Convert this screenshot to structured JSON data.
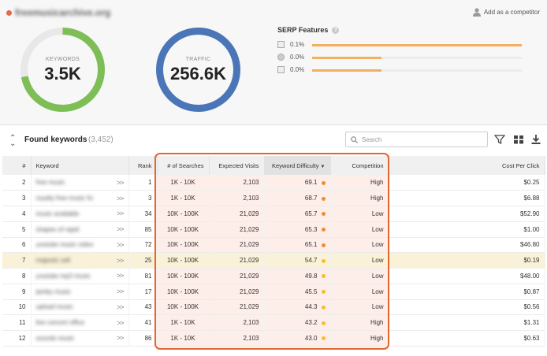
{
  "header": {
    "domain": "freemusicarchive.org",
    "add_competitor_label": "Add as a competitor",
    "add_competitor_icon": "user-icon"
  },
  "keywords_donut": {
    "label": "KEYWORDS",
    "value": "3.5K",
    "fill_fraction": 0.72,
    "color": "#7dbe57"
  },
  "traffic_donut": {
    "label": "TRAFFIC",
    "value": "256.6K",
    "fill_fraction": 1.0,
    "color": "#4a76b8"
  },
  "serp": {
    "title": "SERP Features",
    "help_icon": "help-icon",
    "rows": [
      {
        "icon": "image-icon",
        "pct": "0.1%",
        "fill_fraction": 1.0
      },
      {
        "icon": "circle-icon",
        "pct": "0.0%",
        "fill_fraction": 0.33
      },
      {
        "icon": "snippet-icon",
        "pct": "0.0%",
        "fill_fraction": 0.33
      }
    ],
    "bar_color": "#f3ae62"
  },
  "found": {
    "title": "Found keywords",
    "count": "(3,452)",
    "search_placeholder": "Search",
    "tools": [
      "filter-icon",
      "grid-icon",
      "download-icon"
    ]
  },
  "table": {
    "columns": [
      "#",
      "Keyword",
      "Rank",
      "# of Searches",
      "Expected Visits",
      "Keyword Difficulty",
      "Competition",
      "Cost Per Click"
    ],
    "rows": [
      {
        "n": "2",
        "keyword": "free music",
        "rank": "1",
        "searches": "1K - 10K",
        "visits": "2,103",
        "difficulty": "69.1",
        "dot": "#f08c2c",
        "competition": "High",
        "cpc": "$0.25"
      },
      {
        "n": "3",
        "keyword": "royalty free music for",
        "rank": "3",
        "searches": "1K - 10K",
        "visits": "2,103",
        "difficulty": "68.7",
        "dot": "#f08c2c",
        "competition": "High",
        "cpc": "$6.88"
      },
      {
        "n": "4",
        "keyword": "music available",
        "rank": "34",
        "searches": "10K - 100K",
        "visits": "21,029",
        "difficulty": "65.7",
        "dot": "#f08c2c",
        "competition": "Low",
        "cpc": "$52.90"
      },
      {
        "n": "5",
        "keyword": "shapes of rapid",
        "rank": "85",
        "searches": "10K - 100K",
        "visits": "21,029",
        "difficulty": "65.3",
        "dot": "#f08c2c",
        "competition": "Low",
        "cpc": "$1.00"
      },
      {
        "n": "6",
        "keyword": "youtube music videos",
        "rank": "72",
        "searches": "10K - 100K",
        "visits": "21,029",
        "difficulty": "65.1",
        "dot": "#f08c2c",
        "competition": "Low",
        "cpc": "$46.80"
      },
      {
        "n": "7",
        "keyword": "majestic sell",
        "rank": "25",
        "searches": "10K - 100K",
        "visits": "21,029",
        "difficulty": "54.7",
        "dot": "#f2c12e",
        "competition": "Low",
        "cpc": "$0.19"
      },
      {
        "n": "8",
        "keyword": "youtube mp3 music",
        "rank": "81",
        "searches": "10K - 100K",
        "visits": "21,029",
        "difficulty": "49.8",
        "dot": "#f2c12e",
        "competition": "Low",
        "cpc": "$48.00"
      },
      {
        "n": "9",
        "keyword": "jamby music",
        "rank": "17",
        "searches": "10K - 100K",
        "visits": "21,029",
        "difficulty": "45.5",
        "dot": "#f2c12e",
        "competition": "Low",
        "cpc": "$0.87"
      },
      {
        "n": "10",
        "keyword": "upload music",
        "rank": "43",
        "searches": "10K - 100K",
        "visits": "21,029",
        "difficulty": "44.3",
        "dot": "#f2c12e",
        "competition": "Low",
        "cpc": "$0.56"
      },
      {
        "n": "11",
        "keyword": "live concert office",
        "rank": "41",
        "searches": "1K - 10K",
        "visits": "2,103",
        "difficulty": "43.2",
        "dot": "#f2c12e",
        "competition": "High",
        "cpc": "$1.31"
      },
      {
        "n": "12",
        "keyword": "sounds music",
        "rank": "86",
        "searches": "1K - 10K",
        "visits": "2,103",
        "difficulty": "43.0",
        "dot": "#f2c12e",
        "competition": "High",
        "cpc": "$0.63"
      }
    ],
    "selected_row": 5,
    "sort_icon": "sort-desc-icon",
    "highlight_color": "#e4662f"
  }
}
